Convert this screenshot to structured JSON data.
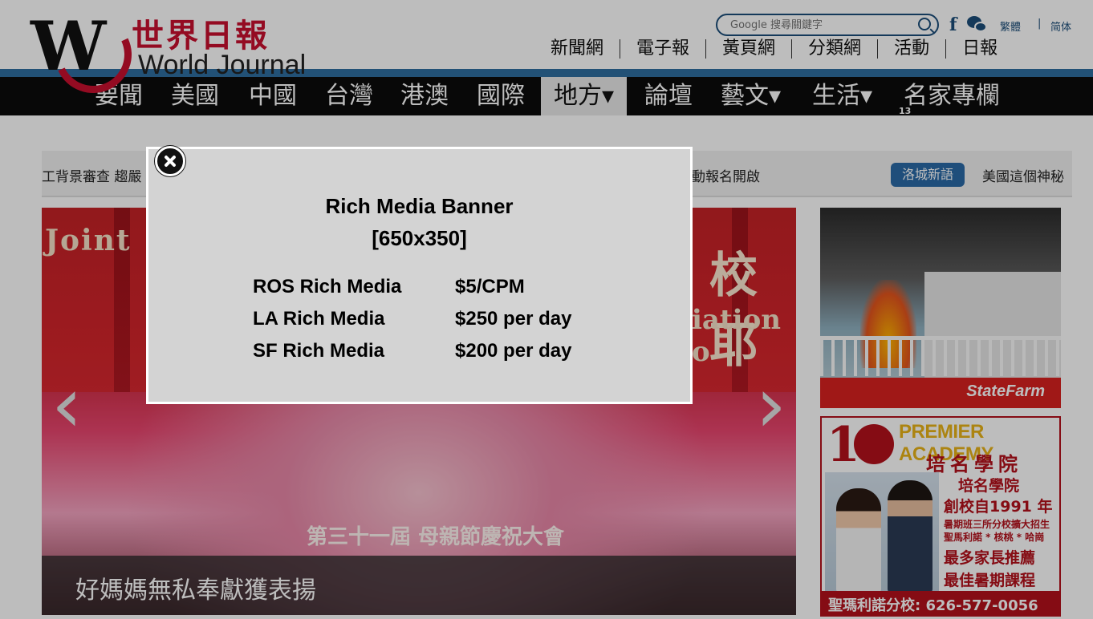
{
  "logo": {
    "letter": "W",
    "chinese": "世界日報",
    "english": "World Journal"
  },
  "search": {
    "placeholder": "Google 搜尋關鍵字"
  },
  "lang": {
    "traditional": "繁體",
    "separator": "|",
    "simplified": "简体"
  },
  "topnav": [
    "新聞網",
    "電子報",
    "黃頁網",
    "分類網",
    "活動",
    "日報"
  ],
  "mainnav": [
    "要聞",
    "美國",
    "中國",
    "台灣",
    "港澳",
    "國際",
    "地方▾",
    "論壇",
    "藝文▾",
    "生活▾",
    "名家專欄"
  ],
  "nav_badge": "13",
  "ticker": {
    "left": "工背景審查 趨嚴",
    "mid": "動報名開啟",
    "tag": "洛城新語",
    "right": "美國這個神秘"
  },
  "slider": {
    "bg_text_left": "Joint",
    "bg_text_right": "校 耶",
    "bg_text_assoc": "iation o",
    "bg_event": "第三十一屆  母親節慶祝大會",
    "caption": "好媽媽無私奉獻獲表揚",
    "prev_glyph": "‹",
    "next_glyph": "›"
  },
  "ads": {
    "statefarm": {
      "brand": "StateFarm"
    },
    "academy": {
      "title": "PREMIER ACADEMY",
      "title_cn": "培名學院",
      "line1": "培名學院",
      "line2": "創校自1991 年",
      "line3": "暑期班三所分校擴大招生",
      "line4": "聖馬利諾 * 核桃 * 哈崗",
      "line5": "最多家長推薦",
      "line6": "最佳暑期課程",
      "footer": "聖瑪利諾分校: 626-577-0056"
    }
  },
  "modal": {
    "title": "Rich Media Banner",
    "size": "[650x350]",
    "rates": [
      {
        "name": "ROS Rich Media",
        "price": "$5/CPM"
      },
      {
        "name": "LA Rich Media",
        "price": "$250 per day"
      },
      {
        "name": "SF Rich Media",
        "price": "$200 per day"
      }
    ]
  },
  "colors": {
    "brand_red": "#c8102e",
    "nav_blue": "#2f6e9f",
    "nav_black": "#0b0b0b",
    "modal_bg": "#d3d3d3"
  }
}
